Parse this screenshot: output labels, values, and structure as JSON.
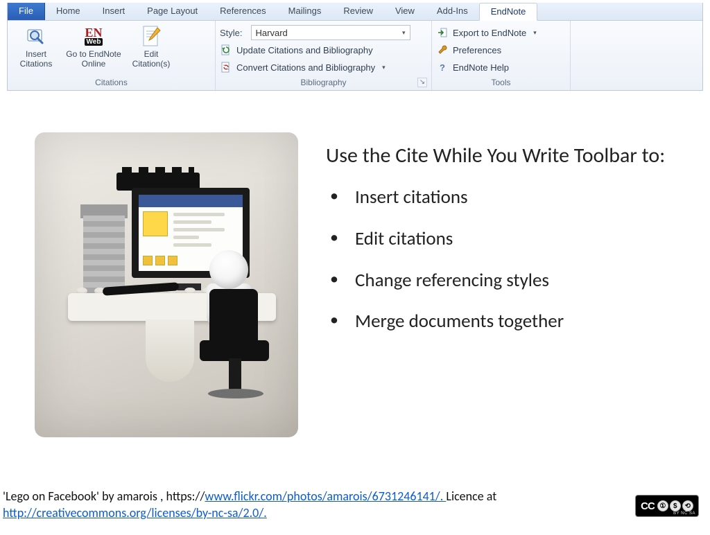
{
  "ribbon": {
    "tabs": {
      "file": "File",
      "home": "Home",
      "insert": "Insert",
      "pagelayout": "Page Layout",
      "references": "References",
      "mailings": "Mailings",
      "review": "Review",
      "view": "View",
      "addins": "Add-Ins",
      "endnote": "EndNote"
    },
    "citations": {
      "group_label": "Citations",
      "insert_citations": "Insert Citations",
      "goto_online": "Go to EndNote Online",
      "edit_citations": "Edit Citation(s)"
    },
    "bibliography": {
      "group_label": "Bibliography",
      "style_label": "Style:",
      "style_value": "Harvard",
      "update": "Update Citations and Bibliography",
      "convert": "Convert Citations and Bibliography"
    },
    "tools": {
      "group_label": "Tools",
      "export": "Export to EndNote",
      "preferences": "Preferences",
      "help": "EndNote Help"
    }
  },
  "body": {
    "heading": "Use the Cite While You Write Toolbar to:",
    "bullets": {
      "b1": "Insert citations",
      "b2": "Edit citations",
      "b3": "Change referencing styles",
      "b4": "Merge documents together"
    }
  },
  "attribution": {
    "prefix": "'Lego on Facebook' by amarois , https://",
    "link1_text": "www.flickr.com/photos/amarois/6731246141/. ",
    "mid": "Licence at ",
    "link2_text": "http://creativecommons.org/licenses/by-nc-sa/2.0/."
  },
  "cc": {
    "label": "CC",
    "by": "BY",
    "nc": "NC",
    "sa": "SA",
    "sub": "BY   NC   SA"
  }
}
